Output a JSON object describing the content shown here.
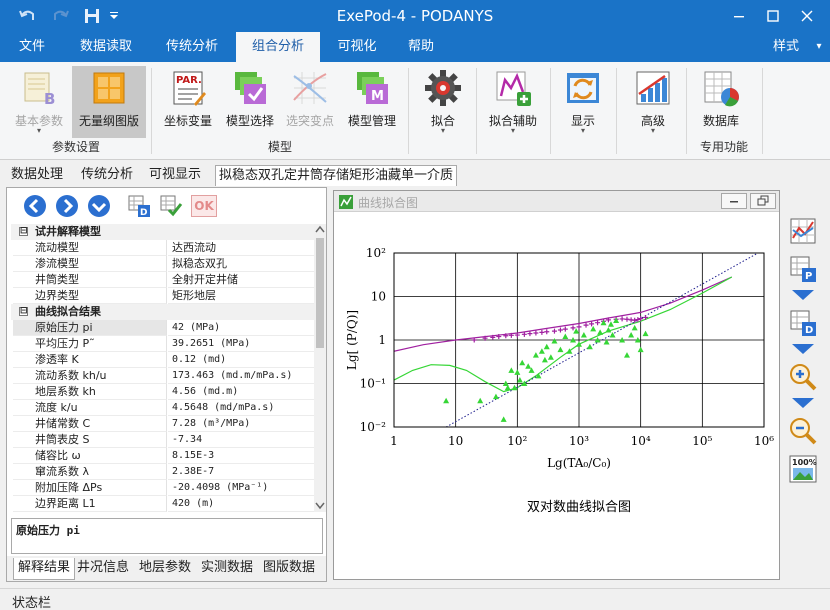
{
  "window": {
    "title": "ExePod-4   - PODANYS",
    "controls": {
      "minimize": "—",
      "maximize": "□",
      "close": "✕"
    }
  },
  "menu": {
    "items": [
      {
        "label": "文件"
      },
      {
        "label": "数据读取"
      },
      {
        "label": "传统分析"
      },
      {
        "label": "组合分析",
        "active": true
      },
      {
        "label": "可视化"
      },
      {
        "label": "帮助"
      }
    ],
    "style_label": "样式",
    "style_caret": "▾"
  },
  "ribbon": {
    "buttons": [
      {
        "label": "基本参数",
        "icon": "base-params-icon",
        "state": "disabled",
        "dropdown": "▾"
      },
      {
        "label": "无量纲图版",
        "icon": "dimensionless-chart-icon",
        "state": "selected"
      },
      {
        "label": "坐标变量",
        "icon": "par-coordinate-icon"
      },
      {
        "label": "模型选择",
        "icon": "model-select-icon"
      },
      {
        "label": "选突变点",
        "icon": "breakpoint-icon",
        "state": "disabled"
      },
      {
        "label": "模型管理",
        "icon": "model-manage-icon"
      },
      {
        "label": "拟合",
        "icon": "gear-icon",
        "dropdown": "▾"
      },
      {
        "label": "拟合辅助",
        "icon": "fit-assist-icon",
        "dropdown": "▾"
      },
      {
        "label": "显示",
        "icon": "refresh-display-icon",
        "dropdown": "▾"
      },
      {
        "label": "高级",
        "icon": "advanced-chart-icon",
        "dropdown": "▾"
      },
      {
        "label": "数据库",
        "icon": "database-icon"
      }
    ],
    "groups": {
      "params": "参数设置",
      "model": "模型",
      "special": "专用功能"
    }
  },
  "doc_tabs": [
    {
      "label": "数据处理"
    },
    {
      "label": "传统分析"
    },
    {
      "label": "可视显示"
    },
    {
      "label": "拟稳态双孔定井筒存储矩形油藏单一介质",
      "active": true
    }
  ],
  "navbar": {
    "ok_label": "OK"
  },
  "property_grid": {
    "categories": [
      {
        "title": "试井解释模型",
        "toggle": "⊟",
        "rows": [
          {
            "key": "流动模型",
            "value": "达西流动"
          },
          {
            "key": "渗流模型",
            "value": "拟稳态双孔"
          },
          {
            "key": "井筒类型",
            "value": "全射开定井储"
          },
          {
            "key": "边界类型",
            "value": "矩形地层"
          }
        ]
      },
      {
        "title": "曲线拟合结果",
        "toggle": "⊟",
        "rows": [
          {
            "key": "原始压力 pi",
            "value": "42 (MPa)",
            "selected": true
          },
          {
            "key": "平均压力 P˜",
            "value": "39.2651 (MPa)"
          },
          {
            "key": "渗透率 K",
            "value": "0.12 (md)"
          },
          {
            "key": "流动系数 kh/u",
            "value": "173.463 (md.m/mPa.s)"
          },
          {
            "key": "地层系数 kh",
            "value": "4.56 (md.m)"
          },
          {
            "key": "流度 k/u",
            "value": "4.5648 (md/mPa.s)"
          },
          {
            "key": "井储常数 C",
            "value": "7.28 (m³/MPa)"
          },
          {
            "key": "井筒表皮 S",
            "value": "-7.34"
          },
          {
            "key": "储容比 ω",
            "value": "8.15E-3"
          },
          {
            "key": "窜流系数 λ",
            "value": "2.38E-7"
          },
          {
            "key": "附加压降 ΔPs",
            "value": "-20.4098 (MPa⁻¹)"
          },
          {
            "key": "边界距离 L1",
            "value": "420 (m)"
          }
        ]
      }
    ],
    "description": "原始压力 pi"
  },
  "bottom_tabs": [
    {
      "label": "解释结果",
      "active": true
    },
    {
      "label": "井况信息"
    },
    {
      "label": "地层参数"
    },
    {
      "label": "实测数据"
    },
    {
      "label": "图版数据"
    }
  ],
  "plot_window": {
    "title": "曲线拟合图",
    "caption": "双对数曲线拟合图"
  },
  "chart_data": {
    "type": "scatter",
    "log_scale": {
      "x": true,
      "y": true
    },
    "xlabel": "Lg(TA₀/C₀)",
    "ylabel": "Lg[ (P/Q)]",
    "xlim": [
      1,
      1000000
    ],
    "ylim": [
      0.01,
      100
    ],
    "x_ticks": [
      "1",
      "10",
      "10²",
      "10³",
      "10⁴",
      "10⁵",
      "10⁶"
    ],
    "y_ticks": [
      "10⁻²",
      "10⁻¹",
      "1",
      "10",
      "10²"
    ],
    "grid": true,
    "colors": {
      "purple": "#a020a0",
      "green": "#36d636",
      "reference": "#1c1c8c"
    },
    "series": [
      {
        "kind": "line",
        "color": "purple",
        "x": [
          1,
          3,
          10,
          30,
          100,
          300,
          1000,
          3000,
          10000,
          30000,
          100000,
          300000
        ],
        "y": [
          0.55,
          0.78,
          1.0,
          1.2,
          1.45,
          1.85,
          2.4,
          3.2,
          4.3,
          7,
          14,
          28
        ]
      },
      {
        "kind": "line",
        "color": "green",
        "x": [
          1,
          2,
          4,
          8,
          15,
          30,
          60,
          100,
          200,
          500,
          1000,
          3000,
          10000,
          30000,
          100000,
          300000
        ],
        "y": [
          0.12,
          0.2,
          0.27,
          0.26,
          0.2,
          0.11,
          0.065,
          0.08,
          0.15,
          0.4,
          0.8,
          1.6,
          2.7,
          5,
          12,
          28
        ]
      },
      {
        "kind": "line",
        "color": "reference",
        "x": [
          7,
          800000
        ],
        "y": [
          0.01,
          100
        ]
      },
      {
        "kind": "plus",
        "color": "purple",
        "x": [
          20,
          30,
          40,
          50,
          65,
          80,
          100,
          130,
          160,
          200,
          250,
          300,
          400,
          500,
          600,
          800,
          1000,
          1300,
          1600,
          2000,
          2500,
          3000,
          4000,
          5000,
          6000,
          7000,
          8000,
          9000,
          10000,
          12000
        ],
        "y": [
          1.0,
          1.1,
          1.15,
          1.2,
          1.25,
          1.28,
          1.3,
          1.35,
          1.4,
          1.45,
          1.5,
          1.55,
          1.6,
          1.7,
          1.78,
          1.9,
          2.0,
          2.2,
          2.35,
          2.5,
          2.7,
          2.9,
          3.0,
          3.05,
          3.0,
          2.9,
          2.85,
          2.95,
          3.1,
          3.3
        ]
      },
      {
        "kind": "triangle",
        "color": "green",
        "x": [
          7,
          25,
          45,
          60,
          65,
          70,
          80,
          90,
          100,
          110,
          120,
          130,
          150,
          170,
          200,
          220,
          250,
          280,
          300,
          350,
          400,
          500,
          600,
          700,
          800,
          900,
          1000,
          1200,
          1500,
          1700,
          2000,
          2200,
          2500,
          2800,
          3000,
          3300,
          3500,
          4000,
          5000,
          6000,
          7000,
          8000,
          9000,
          10000,
          12000
        ],
        "y": [
          0.04,
          0.04,
          0.05,
          0.015,
          0.1,
          0.08,
          0.2,
          0.08,
          0.18,
          0.12,
          0.3,
          0.1,
          0.25,
          0.2,
          0.45,
          0.15,
          0.55,
          0.35,
          0.7,
          0.4,
          0.95,
          0.6,
          1.2,
          0.55,
          1.0,
          1.6,
          0.8,
          1.3,
          0.7,
          1.8,
          1.0,
          1.5,
          2.5,
          0.9,
          1.7,
          2.3,
          1.3,
          2.8,
          1.0,
          0.45,
          1.3,
          1.9,
          1.0,
          0.6,
          1.4
        ]
      }
    ]
  },
  "status_bar": {
    "label": "状态栏"
  }
}
